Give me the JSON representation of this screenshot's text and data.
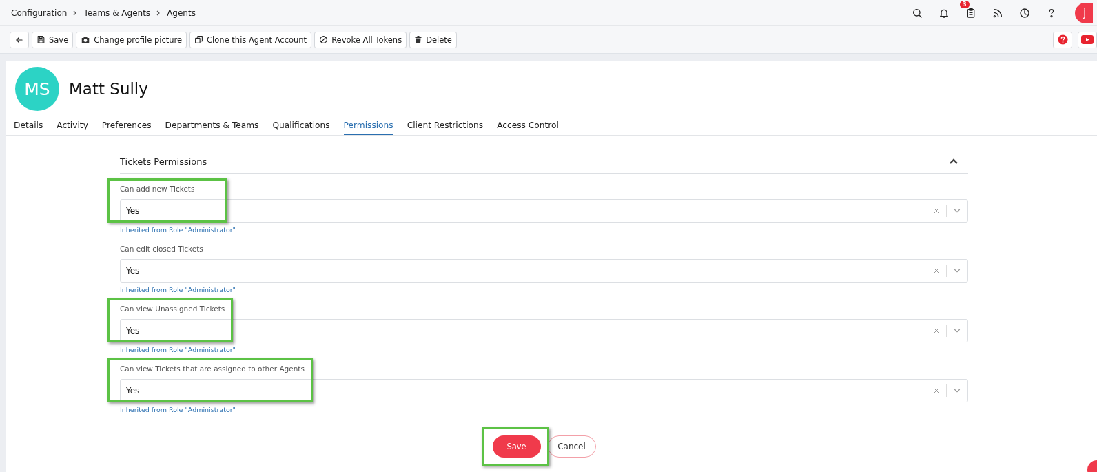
{
  "breadcrumb": [
    "Configuration",
    "Teams & Agents",
    "Agents"
  ],
  "header_icons": [
    {
      "kind": "search"
    },
    {
      "kind": "bell"
    },
    {
      "kind": "clipboard",
      "badge": "3"
    },
    {
      "kind": "rss"
    },
    {
      "kind": "clock"
    },
    {
      "kind": "help"
    }
  ],
  "user_avatar": {
    "initial": "j"
  },
  "toolbar": [
    {
      "kind": "back"
    },
    {
      "kind": "save",
      "label": "Save"
    },
    {
      "kind": "camera",
      "label": "Change profile picture"
    },
    {
      "kind": "clone",
      "label": "Clone this Agent Account"
    },
    {
      "kind": "revoke",
      "label": "Revoke All Tokens"
    },
    {
      "kind": "trash",
      "label": "Delete"
    }
  ],
  "toolbar_right": [
    {
      "kind": "help"
    },
    {
      "kind": "video"
    }
  ],
  "profile": {
    "initials": "MS",
    "name": "Matt Sully"
  },
  "tabs": [
    {
      "label": "Details",
      "selected": false
    },
    {
      "label": "Activity",
      "selected": false
    },
    {
      "label": "Preferences",
      "selected": false
    },
    {
      "label": "Departments & Teams",
      "selected": false
    },
    {
      "label": "Qualifications",
      "selected": false
    },
    {
      "label": "Permissions",
      "selected": true
    },
    {
      "label": "Client Restrictions",
      "selected": false
    },
    {
      "label": "Access Control",
      "selected": false
    }
  ],
  "section": {
    "title": "Tickets Permissions",
    "expanded": true,
    "fields": [
      {
        "label": "Can add new Tickets",
        "value": "Yes",
        "note": "Inherited from Role \"Administrator\"",
        "highlighted": true
      },
      {
        "label": "Can edit closed Tickets",
        "value": "Yes",
        "note": "Inherited from Role \"Administrator\"",
        "highlighted": false
      },
      {
        "label": "Can view Unassigned Tickets",
        "value": "Yes",
        "note": "Inherited from Role \"Administrator\"",
        "highlighted": true
      },
      {
        "label": "Can view Tickets that are assigned to other Agents",
        "value": "Yes",
        "note": "Inherited from Role \"Administrator\"",
        "highlighted": true
      }
    ]
  },
  "actions": {
    "save": {
      "label": "Save",
      "highlighted": true
    },
    "cancel": {
      "label": "Cancel"
    }
  }
}
